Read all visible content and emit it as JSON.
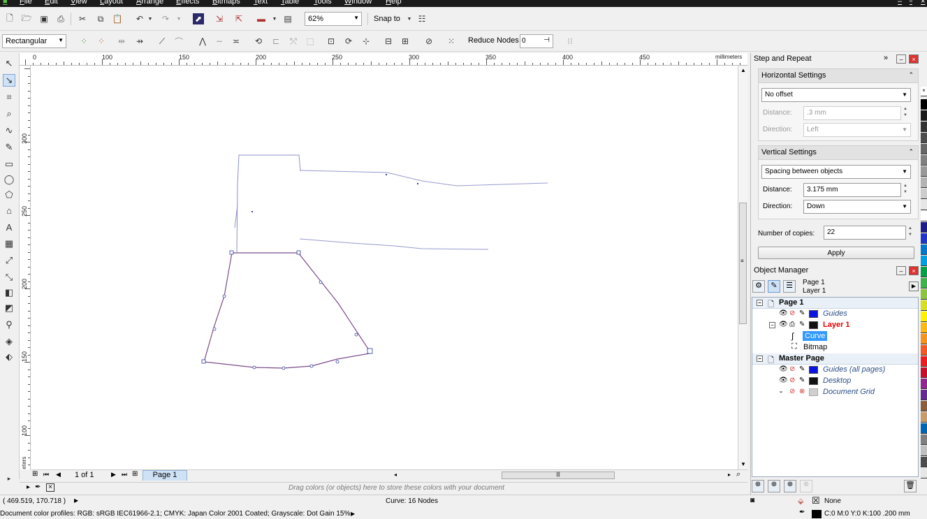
{
  "menu": [
    "File",
    "Edit",
    "View",
    "Layout",
    "Arrange",
    "Effects",
    "Bitmaps",
    "Text",
    "Table",
    "Tools",
    "Window",
    "Help"
  ],
  "toolbar": {
    "zoom": "62%",
    "snap_to": "Snap to"
  },
  "property_bar": {
    "shape": "Rectangular",
    "reduce_nodes_label": "Reduce Nodes",
    "reduce_nodes_value": "0"
  },
  "ruler": {
    "h_labels": [
      "0",
      "100",
      "150",
      "200",
      "250",
      "300",
      "350",
      "400",
      "450"
    ],
    "unit": "millimeters",
    "v_labels": [
      "300",
      "250",
      "200",
      "150",
      "100"
    ]
  },
  "page_nav": {
    "page_count": "1 of 1",
    "tab": "Page 1"
  },
  "color_tray_hint": "Drag colors (or objects) here to store these colors with your document",
  "step_repeat": {
    "title": "Step and Repeat",
    "horizontal": {
      "title": "Horizontal Settings",
      "mode": "No offset",
      "distance_label": "Distance:",
      "distance": ".3 mm",
      "direction_label": "Direction:",
      "direction": "Left"
    },
    "vertical": {
      "title": "Vertical Settings",
      "mode": "Spacing between objects",
      "distance_label": "Distance:",
      "distance": "3.175 mm",
      "direction_label": "Direction:",
      "direction": "Down"
    },
    "copies_label": "Number of copies:",
    "copies": "22",
    "apply": "Apply"
  },
  "object_manager": {
    "title": "Object Manager",
    "current_page": "Page 1",
    "current_layer": "Layer 1",
    "tree": {
      "page1": "Page 1",
      "guides": "Guides",
      "layer1": "Layer 1",
      "curve": "Curve",
      "bitmap": "Bitmap",
      "master": "Master Page",
      "guides_all": "Guides (all pages)",
      "desktop": "Desktop",
      "grid": "Document Grid"
    }
  },
  "status": {
    "coords": "( 469.519, 170.718 )",
    "selection": "Curve: 16 Nodes",
    "fill": "None",
    "outline": "C:0 M:0 Y:0 K:100  .200 mm",
    "profiles": "Document color profiles: RGB: sRGB IEC61966-2.1; CMYK: Japan Color 2001 Coated; Grayscale: Dot Gain 15%"
  },
  "colors": {
    "accent": "#3399ff",
    "layer_red": "#e60000",
    "curve_line": "#5a5fa8"
  }
}
